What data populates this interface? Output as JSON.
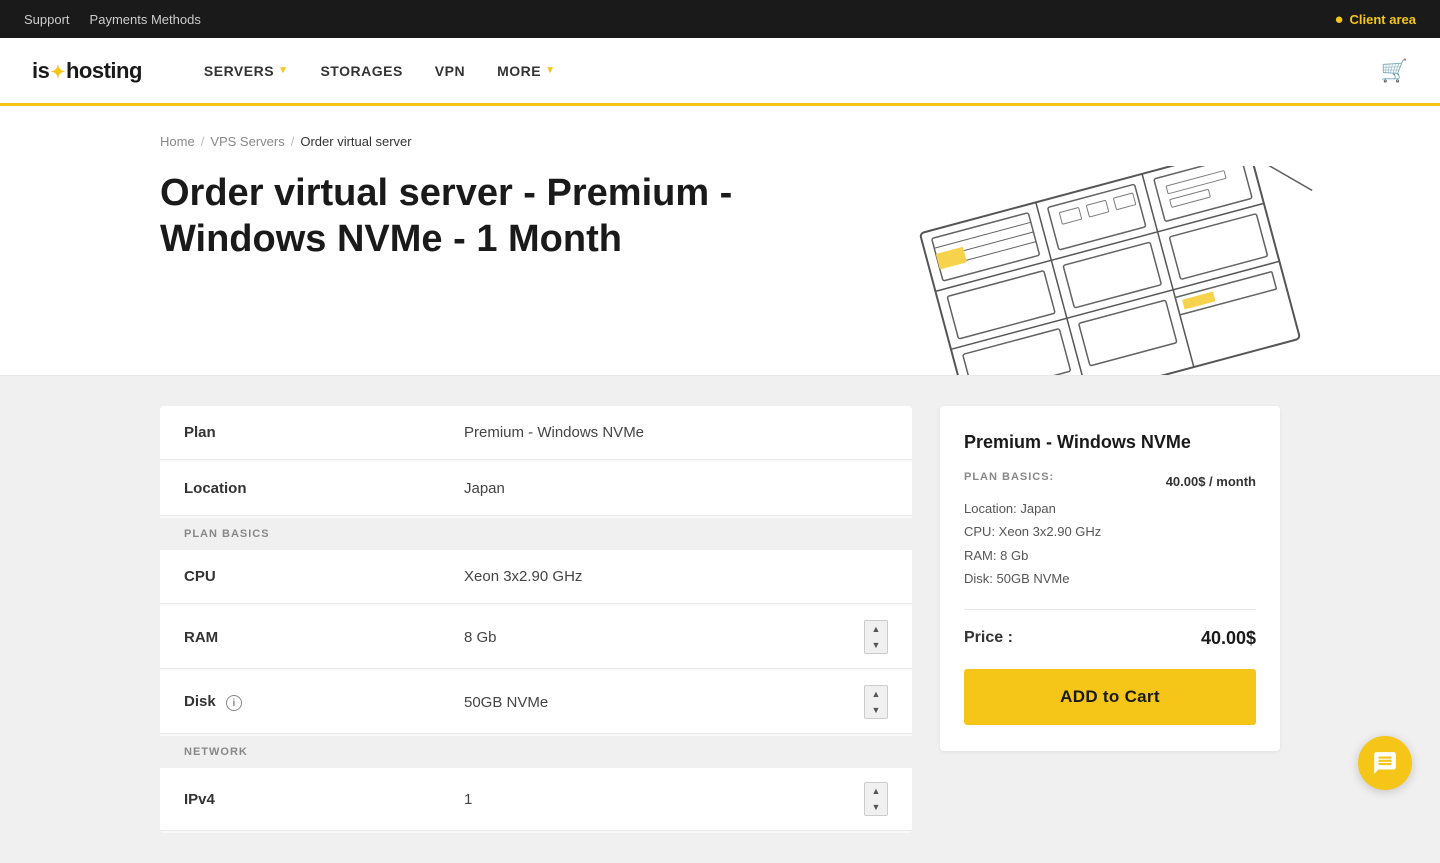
{
  "topbar": {
    "links": [
      "Support",
      "Payments Methods"
    ],
    "client_area": "Client area"
  },
  "navbar": {
    "logo": "is*hosting",
    "nav_items": [
      {
        "label": "SERVERS",
        "has_caret": true
      },
      {
        "label": "STORAGES",
        "has_caret": false
      },
      {
        "label": "VPN",
        "has_caret": false
      },
      {
        "label": "MORE",
        "has_caret": true
      }
    ]
  },
  "breadcrumb": {
    "home": "Home",
    "vps": "VPS Servers",
    "current": "Order virtual server"
  },
  "hero": {
    "title": "Order virtual server - Premium - Windows NVMe - 1 Month"
  },
  "config": {
    "section_plan_label": "PLAN BASICS",
    "section_network_label": "NETWORK",
    "rows": [
      {
        "label": "Plan",
        "value": "Premium - Windows NVMe"
      },
      {
        "label": "Location",
        "value": "Japan"
      }
    ],
    "plan_basics": [
      {
        "label": "CPU",
        "value": "Xeon 3x2.90 GHz",
        "has_info": false,
        "has_stepper": false
      },
      {
        "label": "RAM",
        "value": "8 Gb",
        "has_info": false,
        "has_stepper": true
      },
      {
        "label": "Disk",
        "value": "50GB NVMe",
        "has_info": true,
        "has_stepper": true
      }
    ],
    "network": [
      {
        "label": "IPv4",
        "value": "1",
        "has_stepper": true
      }
    ]
  },
  "summary": {
    "plan_name": "Premium - Windows NVMe",
    "plan_basics_label": "PLAN BASICS:",
    "plan_basics_price": "40.00$ / month",
    "details": [
      "Location: Japan",
      "CPU: Xeon 3x2.90 GHz",
      "RAM: 8 Gb",
      "Disk: 50GB NVMe"
    ],
    "price_label": "Price :",
    "price_value": "40.00$",
    "add_to_cart": "ADD to Cart",
    "add_bold": "ADD",
    "add_rest": " to Cart"
  }
}
